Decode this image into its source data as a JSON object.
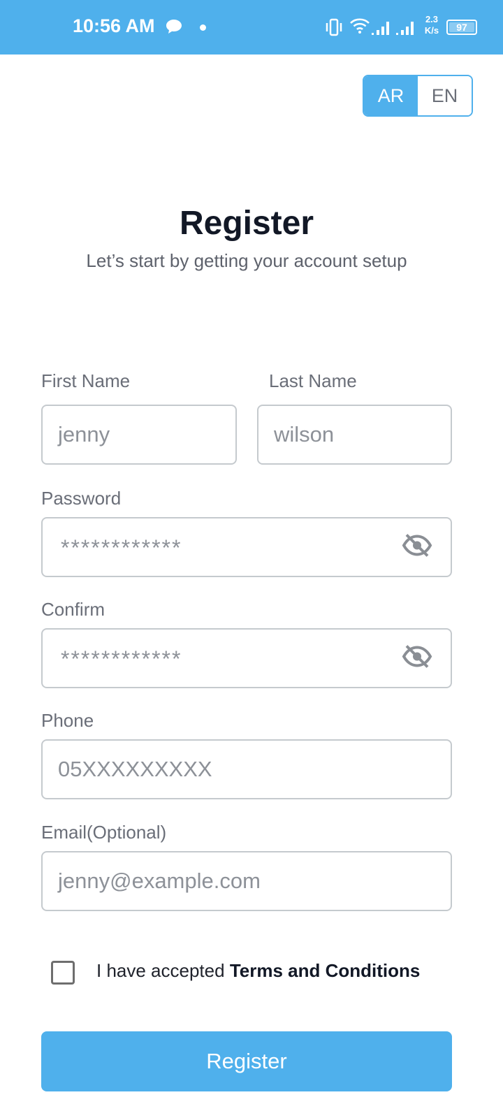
{
  "status_bar": {
    "time": "10:56 AM",
    "speed_value": "2.3",
    "speed_unit": "K/s",
    "battery": "97",
    "icons": [
      "chat-bubble-icon",
      "notification-dot-icon",
      "vibrate-icon",
      "wifi-icon",
      "signal-icon",
      "signal-icon",
      "battery-icon"
    ]
  },
  "language": {
    "ar_label": "AR",
    "en_label": "EN",
    "selected": "AR"
  },
  "header": {
    "title": "Register",
    "subtitle": "Let’s start by getting your account setup"
  },
  "form": {
    "first_name": {
      "label": "First Name",
      "value": "jenny"
    },
    "last_name": {
      "label": "Last Name",
      "value": "wilson"
    },
    "password": {
      "label": "Password",
      "value": "************",
      "toggle_icon": "eye-off-icon"
    },
    "confirm": {
      "label": "Confirm",
      "value": "************",
      "toggle_icon": "eye-off-icon"
    },
    "phone": {
      "label": "Phone",
      "placeholder": "05XXXXXXXXX"
    },
    "email": {
      "label": "Email(Optional)",
      "placeholder": "jenny@example.com"
    }
  },
  "terms": {
    "prefix": "I have accepted ",
    "link": "Terms and Conditions",
    "checked": false
  },
  "submit_label": "Register",
  "colors": {
    "primary": "#4fb0ec",
    "title": "#121826",
    "muted": "#6a6e78",
    "border": "#c5cace"
  }
}
